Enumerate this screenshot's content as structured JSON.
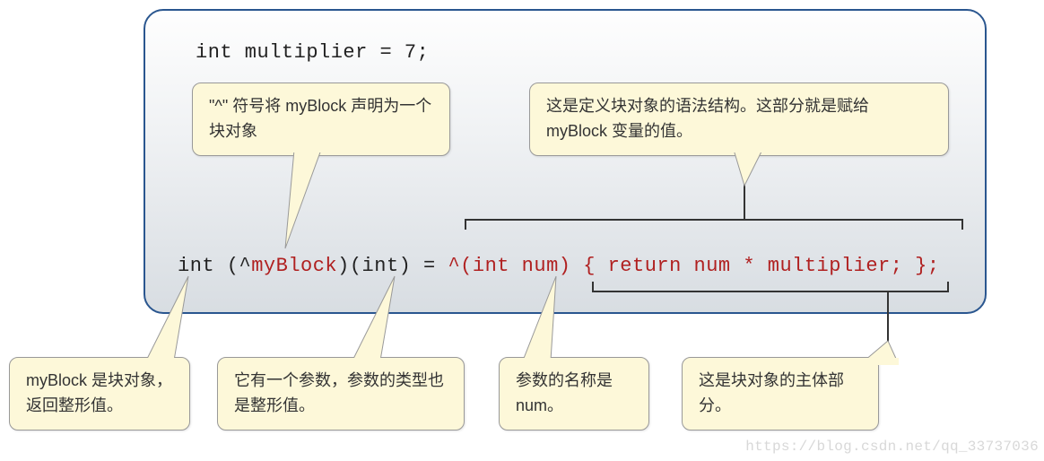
{
  "code": {
    "line1": "int multiplier = 7;",
    "line2_p1": "int (^",
    "line2_p2": "myBlock",
    "line2_p3": ")(int) = ",
    "line2_p4": "^(int num)",
    "line2_p5": " { ",
    "line2_p6": "return num * multiplier;",
    "line2_p7": " };"
  },
  "callouts": {
    "caret": "\"^\" 符号将 myBlock 声明为一个块对象",
    "syntax": "这是定义块对象的语法结构。这部分就是赋给 myBlock 变量的值。",
    "returnType": "myBlock 是块对象，返回整形值。",
    "paramType": "它有一个参数，参数的类型也是整形值。",
    "paramName": "参数的名称是 num。",
    "body": "这是块对象的主体部分。"
  },
  "watermark": "https://blog.csdn.net/qq_33737036"
}
